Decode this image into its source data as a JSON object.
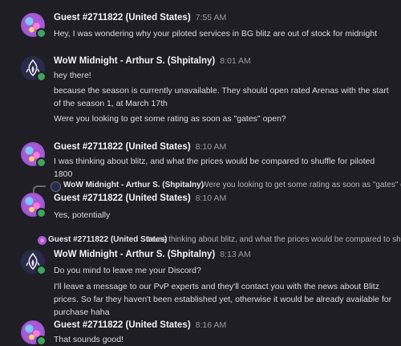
{
  "messages": [
    {
      "author": "Guest #2711822 (United States)",
      "time": "7:55 AM",
      "lines": [
        "Hey, I was wondering why your piloted services in BG blitz are out of stock for midnight"
      ]
    },
    {
      "author": "WoW Midnight - Arthur S. (Shpitalny)",
      "time": "8:01 AM",
      "lines": [
        "hey there!",
        "because the season is currently unavailable. They should open rated Arenas with the start of the season 1, at March 17th",
        "Were you looking to get some rating as soon as \"gates\" open?"
      ]
    },
    {
      "author": "Guest #2711822 (United States)",
      "time": "8:10 AM",
      "lines": [
        "I was thinking about blitz, and what the prices would be compared to shuffle for piloted 1800"
      ]
    },
    {
      "reply": {
        "author": "WoW Midnight - Arthur S. (Shpitalny)",
        "text": "Were you looking to get some rating as soon as \"gates\" open?"
      },
      "author": "Guest #2711822 (United States)",
      "time": "8:10 AM",
      "lines": [
        "Yes, potentially"
      ]
    },
    {
      "reply": {
        "author": "Guest #2711822 (United States)",
        "text": "I was thinking about blitz, and what the prices would be compared to shuffl..."
      },
      "author": "WoW Midnight - Arthur S. (Shpitalny)",
      "time": "8:13 AM",
      "lines": [
        "Do you mind to leave me your Discord?",
        "I'll leave a message to our PvP experts and they'll contact you with the news about Blitz prices. So far they haven't been established yet, otherwise it would be already available for purchase haha"
      ]
    },
    {
      "author": "Guest #2711822 (United States)",
      "time": "8:16 AM",
      "lines": [
        "That sounds good!"
      ]
    }
  ],
  "colors": {
    "background": "#1e1e24",
    "online_status": "#3ba55d",
    "staff_avatar": "#2a2a4a"
  },
  "icons": {
    "guest_avatar": "guest-avatar",
    "staff_avatar": "flame-logo-icon",
    "reply": "reply-arrow-icon"
  }
}
